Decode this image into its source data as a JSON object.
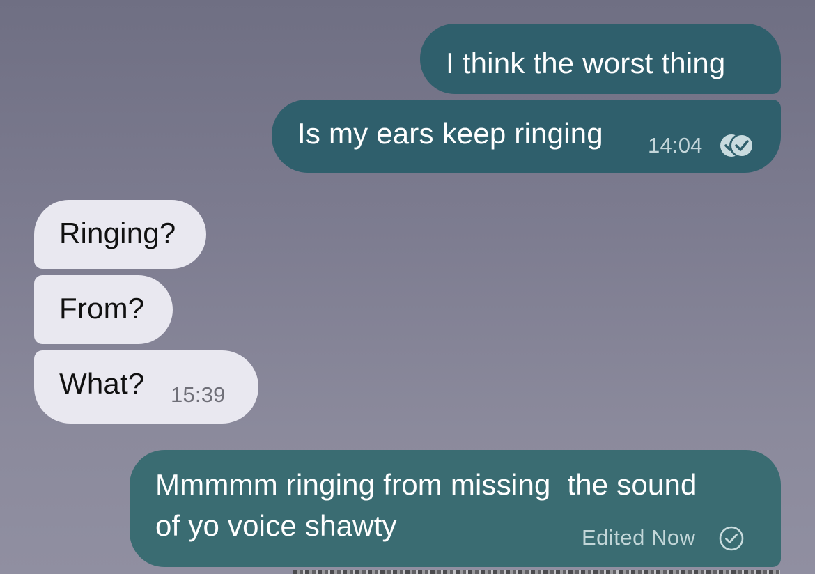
{
  "messages": [
    {
      "direction": "outgoing",
      "text": "I think the worst thing"
    },
    {
      "direction": "outgoing",
      "text": "Is my ears keep ringing",
      "time": "14:04",
      "status_icon": "read-double-check-icon"
    },
    {
      "direction": "incoming",
      "text": "Ringing?"
    },
    {
      "direction": "incoming",
      "text": "From?"
    },
    {
      "direction": "incoming",
      "text": "What?",
      "time": "15:39"
    },
    {
      "direction": "outgoing",
      "lines": [
        "Mmmmm ringing from missing  the sound",
        "of yo voice shawty"
      ],
      "edited_label": "Edited Now",
      "status_icon": "single-check-circle-icon"
    }
  ],
  "colors": {
    "outgoing_bubble": "#2f5f6c",
    "outgoing_bubble_last": "#3a6c72",
    "incoming_bubble": "#e9e8f0",
    "background_top": "#6f6f83",
    "background_bottom": "#908fa1"
  }
}
